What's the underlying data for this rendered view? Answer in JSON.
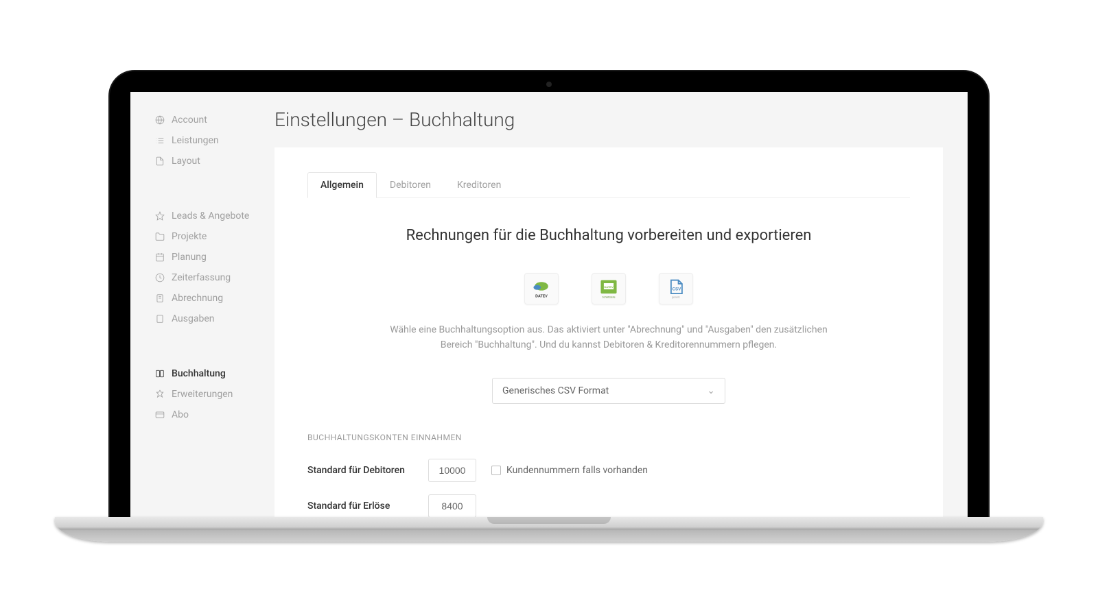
{
  "page": {
    "title": "Einstellungen – Buchhaltung"
  },
  "sidebar": {
    "group1": [
      {
        "label": "Account",
        "icon": "globe"
      },
      {
        "label": "Leistungen",
        "icon": "list"
      },
      {
        "label": "Layout",
        "icon": "document"
      }
    ],
    "group2": [
      {
        "label": "Leads & Angebote",
        "icon": "star"
      },
      {
        "label": "Projekte",
        "icon": "folder"
      },
      {
        "label": "Planung",
        "icon": "calendar"
      },
      {
        "label": "Zeiterfassung",
        "icon": "clock"
      },
      {
        "label": "Abrechnung",
        "icon": "receipt"
      },
      {
        "label": "Ausgaben",
        "icon": "file"
      }
    ],
    "group3": [
      {
        "label": "Buchhaltung",
        "icon": "columns",
        "active": true
      },
      {
        "label": "Erweiterungen",
        "icon": "puzzle"
      },
      {
        "label": "Abo",
        "icon": "card"
      }
    ]
  },
  "tabs": [
    {
      "label": "Allgemein",
      "active": true
    },
    {
      "label": "Debitoren"
    },
    {
      "label": "Kreditoren"
    }
  ],
  "content": {
    "heading": "Rechnungen für die Buchhaltung vorbereiten und exportieren",
    "description": "Wähle eine Buchhaltungsoption aus. Das aktiviert unter \"Abrechnung\" und \"Ausgaben\" den zusätzlichen Bereich \"Buchhaltung\". Und du kannst Debitoren & Kreditorennummern pflegen.",
    "options": [
      {
        "name": "datev",
        "label": "DATEV"
      },
      {
        "name": "datev-schnittstelle",
        "label": "DATEV Schnittstelle"
      },
      {
        "name": "csv",
        "label": "CSV generic"
      }
    ],
    "select_value": "Generisches CSV Format",
    "section_label": "BUCHHALTUNGSKONTEN EINNAHMEN",
    "rows": {
      "debitoren": {
        "label": "Standard für Debitoren",
        "value": "10000",
        "checkbox_label": "Kundennummern falls vorhanden"
      },
      "erloese": {
        "label": "Standard für Erlöse",
        "value": "8400"
      }
    }
  }
}
